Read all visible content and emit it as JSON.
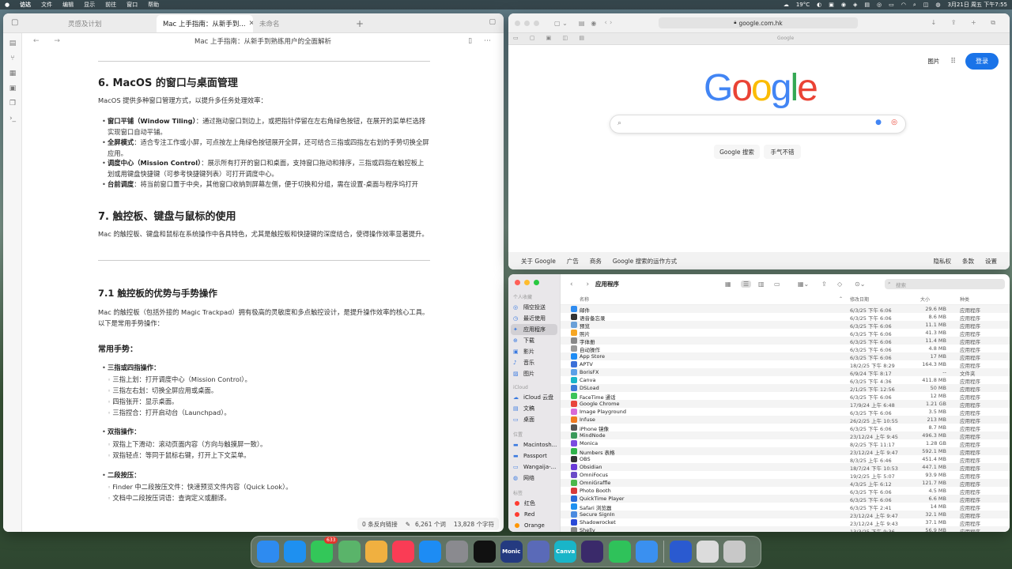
{
  "menubar": {
    "apple": "",
    "app": "访达",
    "items": [
      "文件",
      "编辑",
      "显示",
      "前往",
      "窗口",
      "帮助"
    ],
    "weather": "19°C",
    "datetime": "3月21日 周五 下午7:55"
  },
  "obsidian": {
    "tabs": [
      "灵感及计划",
      "Mac 上手指南：从新手到...",
      "未命名"
    ],
    "title": "Mac 上手指南：从新手到熟练用户的全面解析",
    "h6": "6. MacOS 的窗口与桌面管理",
    "p6": "MacOS 提供多种窗口管理方式，以提升多任务处理效率：",
    "list6": [
      {
        "b": "窗口平铺（Window Tiling）",
        "t": "：通过拖动窗口到边上，或把指针停留在左右角绿色按钮，在展开的菜单栏选择实现窗口自动平铺。"
      },
      {
        "b": "全屏模式",
        "t": "：适合专注工作或小屏，可点按左上角绿色按钮展开全屏，还可结合三指或四指左右划的手势切换全屏应用。"
      },
      {
        "b": "调度中心（Mission Control）",
        "t": "：展示所有打开的窗口和桌面，支持窗口拖动和排序，三指或四指在触控板上划或用键盘快捷键（可参考快捷键列表）可打开调度中心。"
      },
      {
        "b": "台前调度",
        "t": "：将当前窗口置于中央，其他窗口收纳到屏幕左侧，便于切换和分组，需在设置-桌面与程序坞打开"
      }
    ],
    "h7": "7. 触控板、键盘与鼠标的使用",
    "p7": "Mac 的触控板、键盘和鼠标在系统操作中各具特色，尤其是触控板和快捷键的深度结合，使得操作效率显著提升。",
    "h71": "7.1 触控板的优势与手势操作",
    "p71": "Mac 的触控板（包括外接的 Magic Trackpad）拥有极高的灵敏度和多点触控设计，是提升操作效率的核心工具。以下是常用手势操作：",
    "h_common": "常用手势：",
    "g1": "三指或四指操作：",
    "g1a": "三指上划：打开调度中心（Mission Control）。",
    "g1b": "三指左右划：切换全屏应用或桌面。",
    "g1c": "四指张开：显示桌面。",
    "g1d": "三指捏合：打开启动台（Launchpad）。",
    "g2": "双指操作：",
    "g2a": "双指上下滑动：滚动页面内容（方向与触摸屏一致）。",
    "g2b": "双指轻点：等同于鼠标右键，打开上下文菜单。",
    "g3": "二段按压：",
    "g3a": "Finder 中二段按压文件：快速预览文件内容（Quick Look）。",
    "g3b": "文档中二段按压词语：查询定义或翻译。",
    "status": {
      "backlinks": "0 条反向链接",
      "words": "6,261 个词",
      "chars": "13,828 个字符"
    }
  },
  "safari": {
    "address": "google.com.hk",
    "tabTitle": "Google",
    "images": "图片",
    "signin": "登录",
    "btnSearch": "Google 搜索",
    "btnLucky": "手气不错",
    "footer": [
      "关于 Google",
      "广告",
      "商务",
      "Google 搜索的运作方式"
    ],
    "footerRight": [
      "隐私权",
      "条款",
      "设置"
    ],
    "logo": [
      {
        "c": "G",
        "col": "#4285f4"
      },
      {
        "c": "o",
        "col": "#ea4335"
      },
      {
        "c": "o",
        "col": "#fbbc05"
      },
      {
        "c": "g",
        "col": "#4285f4"
      },
      {
        "c": "l",
        "col": "#34a853"
      },
      {
        "c": "e",
        "col": "#ea4335"
      }
    ]
  },
  "finder": {
    "title": "应用程序",
    "searchPlaceholder": "搜索",
    "sections": {
      "fav": "个人收藏",
      "icloud": "iCloud",
      "loc": "位置",
      "tags": "标签"
    },
    "fav": [
      "隔空投送",
      "最近使用",
      "应用程序",
      "下载",
      "影片",
      "音乐",
      "图片"
    ],
    "icloud": [
      "iCloud 云盘",
      "文稿",
      "桌面"
    ],
    "loc": [
      "Macintosh...",
      "Passport",
      "Wangaija-...",
      "网络"
    ],
    "tags": [
      {
        "n": "红色",
        "c": "#ff3b30"
      },
      {
        "n": "Red",
        "c": "#ff3b30"
      },
      {
        "n": "Orange",
        "c": "#ff9500"
      }
    ],
    "cols": {
      "name": "名称",
      "date": "修改日期",
      "size": "大小",
      "kind": "种类"
    },
    "rows": [
      [
        "邮件",
        "6/3/25 下午 6:06",
        "29.6 MB",
        "应用程序",
        "#2f8cf0"
      ],
      [
        "语音备忘录",
        "6/3/25 下午 6:06",
        "8.6 MB",
        "应用程序",
        "#333"
      ],
      [
        "预览",
        "6/3/25 下午 6:06",
        "11.1 MB",
        "应用程序",
        "#6aa0d8"
      ],
      [
        "照片",
        "6/3/25 下午 6:06",
        "41.3 MB",
        "应用程序",
        "#f6a623"
      ],
      [
        "字体册",
        "6/3/25 下午 6:06",
        "11.4 MB",
        "应用程序",
        "#888"
      ],
      [
        "自动操作",
        "6/3/25 下午 6:06",
        "4.8 MB",
        "应用程序",
        "#999"
      ],
      [
        "App Store",
        "6/3/25 下午 6:06",
        "17 MB",
        "应用程序",
        "#1e8cf5"
      ],
      [
        "APTV",
        "18/2/25 下午 8:29",
        "164.3 MB",
        "应用程序",
        "#3b6fd8"
      ],
      [
        "BorisFX",
        "6/9/24 下午 8:17",
        "--",
        "文件夹",
        "#5aa0e8"
      ],
      [
        "Canva",
        "6/3/25 下午 4:36",
        "411.8 MB",
        "应用程序",
        "#19b5c8"
      ],
      [
        "DSLoad",
        "2/1/25 下午 12:56",
        "50 MB",
        "应用程序",
        "#3a7ad8"
      ],
      [
        "FaceTime 通话",
        "6/3/25 下午 6:06",
        "12 MB",
        "应用程序",
        "#3cc45a"
      ],
      [
        "Google Chrome",
        "17/9/24 上午 6:48",
        "1.21 GB",
        "应用程序",
        "#e8453c"
      ],
      [
        "Image Playground",
        "6/3/25 下午 6:06",
        "3.5 MB",
        "应用程序",
        "#d86ad8"
      ],
      [
        "Infuse",
        "26/2/25 上午 10:55",
        "213 MB",
        "应用程序",
        "#f07a20"
      ],
      [
        "iPhone 镜像",
        "6/3/25 下午 6:06",
        "8.7 MB",
        "应用程序",
        "#555"
      ],
      [
        "MindNode",
        "23/12/24 上午 9:45",
        "496.3 MB",
        "应用程序",
        "#3a9a5a"
      ],
      [
        "Monica",
        "8/2/25 下午 11:17",
        "1.28 GB",
        "应用程序",
        "#7b4ae0"
      ],
      [
        "Numbers 表格",
        "23/12/24 上午 9:47",
        "592.1 MB",
        "应用程序",
        "#2fb34a"
      ],
      [
        "OBS",
        "8/3/25 上午 6:46",
        "451.4 MB",
        "应用程序",
        "#333"
      ],
      [
        "Obsidian",
        "18/7/24 下午 10:53",
        "447.1 MB",
        "应用程序",
        "#6a3ad8"
      ],
      [
        "OmniFocus",
        "19/2/25 上午 5:07",
        "93.9 MB",
        "应用程序",
        "#6b4ac8"
      ],
      [
        "OmniGraffle",
        "4/3/25 上午 6:12",
        "121.7 MB",
        "应用程序",
        "#4ab84a"
      ],
      [
        "Photo Booth",
        "6/3/25 下午 6:06",
        "4.5 MB",
        "应用程序",
        "#d83a3a"
      ],
      [
        "QuickTime Player",
        "6/3/25 下午 6:06",
        "6.6 MB",
        "应用程序",
        "#2a6ad8"
      ],
      [
        "Safari 浏览器",
        "6/3/25 下午 2:41",
        "14 MB",
        "应用程序",
        "#1e90f0"
      ],
      [
        "Secure SignIn",
        "23/12/24 上午 9:47",
        "32.1 MB",
        "应用程序",
        "#4a8ae0"
      ],
      [
        "Shadowrocket",
        "23/12/24 上午 9:43",
        "37.1 MB",
        "应用程序",
        "#2a4ad8"
      ],
      [
        "Shelly",
        "13/3/25 下午 9:36",
        "56.9 MB",
        "应用程序",
        "#888"
      ]
    ]
  },
  "dock": [
    {
      "n": "finder",
      "c": "#2e8bf0",
      "t": ""
    },
    {
      "n": "safari",
      "c": "#1e90f0",
      "t": ""
    },
    {
      "n": "messages",
      "c": "#33c759",
      "t": "",
      "badge": "633"
    },
    {
      "n": "maps",
      "c": "#5ab46a",
      "t": ""
    },
    {
      "n": "photos",
      "c": "#f0b040",
      "t": ""
    },
    {
      "n": "music",
      "c": "#fa3c55",
      "t": ""
    },
    {
      "n": "app-store",
      "c": "#1d8cf4",
      "t": ""
    },
    {
      "n": "settings",
      "c": "#8a8a8f",
      "t": ""
    },
    {
      "n": "capcut",
      "c": "#111",
      "t": ""
    },
    {
      "n": "monic",
      "c": "#243a80",
      "t": "Monic"
    },
    {
      "n": "iphone-mirroring",
      "c": "#5a6ab8",
      "t": ""
    },
    {
      "n": "canva",
      "c": "#19b5c8",
      "t": "Canva"
    },
    {
      "n": "obsidian",
      "c": "#3a2a6a",
      "t": ""
    },
    {
      "n": "wechat",
      "c": "#2fc25a",
      "t": ""
    },
    {
      "n": "mail",
      "c": "#3a90f0",
      "t": ""
    },
    {
      "n": "quicktime",
      "c": "#2a5ad0",
      "t": ""
    },
    {
      "n": "preview-doc",
      "c": "#dcdcdc",
      "t": ""
    },
    {
      "n": "trash",
      "c": "#c8c8c8",
      "t": ""
    }
  ]
}
